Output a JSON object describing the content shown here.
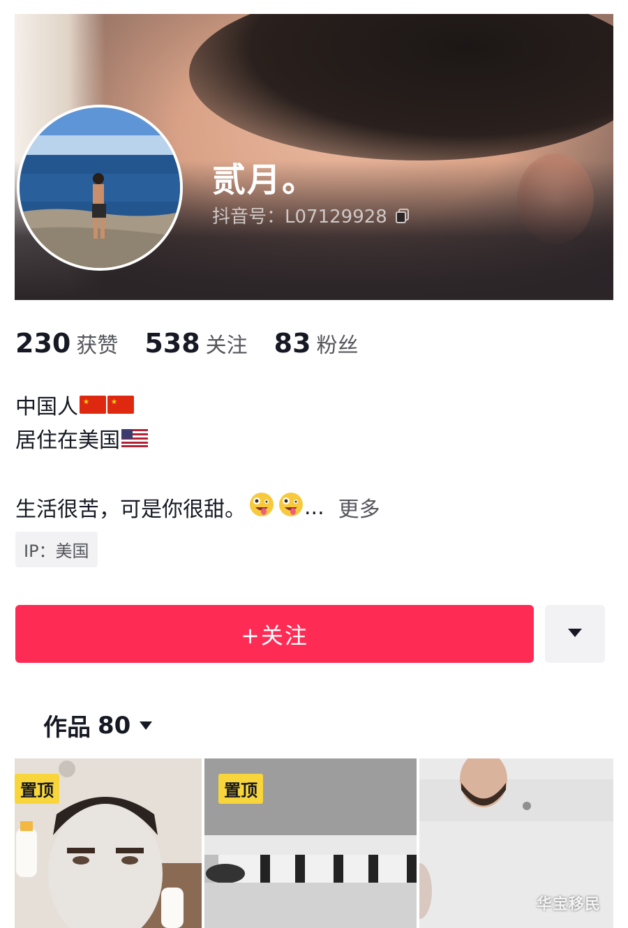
{
  "profile": {
    "nickname": "贰月。",
    "douyin_id": "抖音号：L07129928"
  },
  "stats": [
    {
      "num": "230",
      "label": "获赞"
    },
    {
      "num": "538",
      "label": "关注"
    },
    {
      "num": "83",
      "label": "粉丝"
    }
  ],
  "bio": {
    "line1": "中国人",
    "line2": "居住在美国",
    "motto": "生活很苦，可是你很甜。",
    "ellipsis": "...",
    "more": "更多",
    "ip": "IP：美国"
  },
  "actions": {
    "follow_label": "+关注"
  },
  "works": {
    "label": "作品",
    "count": "80"
  },
  "grid": {
    "pinned_label": "置顶",
    "watermark": "华宝移民"
  },
  "colors": {
    "accent": "#fe2c55",
    "pin_badge": "#f8d63b"
  },
  "icons": [
    "copy-icon",
    "flag-cn-icon",
    "flag-us-icon",
    "zany-face-emoji",
    "chevron-down-icon"
  ]
}
